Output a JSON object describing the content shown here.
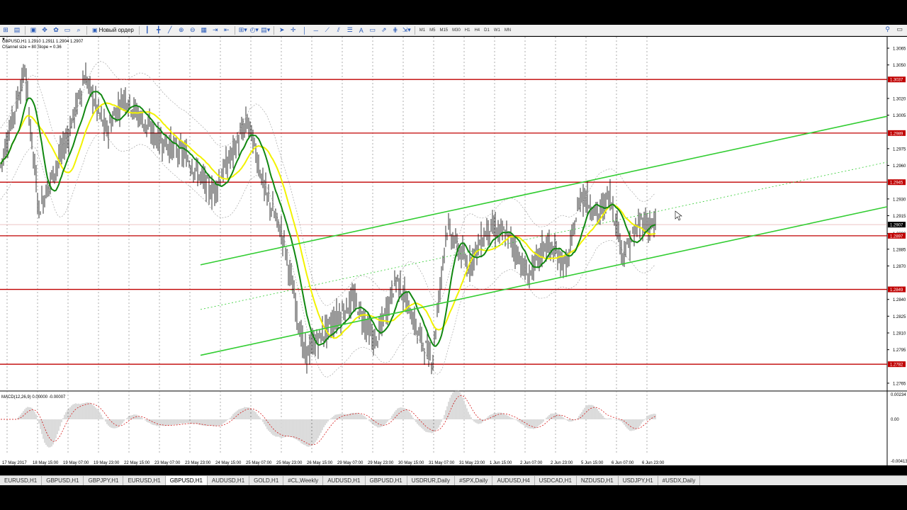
{
  "toolbar": {
    "new_order_label": "Новый ордер",
    "timeframes": [
      "M1",
      "M5",
      "M15",
      "M30",
      "H1",
      "H4",
      "D1",
      "W1",
      "MN"
    ]
  },
  "chart": {
    "info_line": "GBPUSD,H1  1.2910 1.2911 1.2904 1.2907",
    "indicator_line": "Channel size = 80 Slope = 0.36",
    "price_ticks": [
      "1.3065",
      "1.3050",
      "1.3037",
      "1.3020",
      "1.3005",
      "1.2989",
      "1.2975",
      "1.2960",
      "1.2945",
      "1.2930",
      "1.2915",
      "1.2907",
      "1.2899",
      "1.2885",
      "1.2870",
      "1.2849",
      "1.2840",
      "1.2825",
      "1.2810",
      "1.2795",
      "1.2782",
      "1.2765"
    ],
    "level_labels": [
      {
        "price": 1.3037,
        "text": "1.3037"
      },
      {
        "price": 1.2989,
        "text": "1.2989"
      },
      {
        "price": 1.2945,
        "text": "1.2945"
      },
      {
        "price": 1.2897,
        "text": "1.2897"
      },
      {
        "price": 1.2849,
        "text": "1.2849"
      },
      {
        "price": 1.2782,
        "text": "1.2782"
      }
    ],
    "current_price": "1.2907",
    "time_labels": [
      "17 May 2017",
      "18 May 15:00",
      "19 May 07:00",
      "19 May 23:00",
      "22 May 15:00",
      "23 May 07:00",
      "23 May 23:00",
      "24 May 15:00",
      "25 May 07:00",
      "25 May 23:00",
      "26 May 15:00",
      "29 May 07:00",
      "29 May 23:00",
      "30 May 15:00",
      "31 May 07:00",
      "31 May 23:00",
      "1 Jun 15:00",
      "2 Jun 07:00",
      "2 Jun 23:00",
      "5 Jun 15:00",
      "6 Jun 07:00",
      "6 Jun 23:00"
    ],
    "macd_label": "MACD(12,26,9) 0.00000 -0.00007",
    "macd_ticks": [
      "0.00234",
      "0.00",
      "-0.00413"
    ]
  },
  "tabs": [
    "EURUSD,H1",
    "GBPUSD,H1",
    "GBPJPY,H1",
    "EURUSD,H1",
    "GBPUSD,H1",
    "AUDUSD,H1",
    "GOLD,H1",
    "#CL,Weekly",
    "AUDUSD,H1",
    "GBPUSD,H1",
    "USDRUR,Daily",
    "#SPX,Daily",
    "AUDUSD,H4",
    "USDCAD,H1",
    "NZDUSD,H1",
    "USDJPY,H1",
    "#USDX,Daily"
  ],
  "active_tab_index": 4,
  "colors": {
    "levels": "#c00000",
    "channel": "#32cd32",
    "ma_green": "#118811",
    "ma_yellow": "#f2f200",
    "candles": "#000000",
    "bands": "#999999"
  }
}
